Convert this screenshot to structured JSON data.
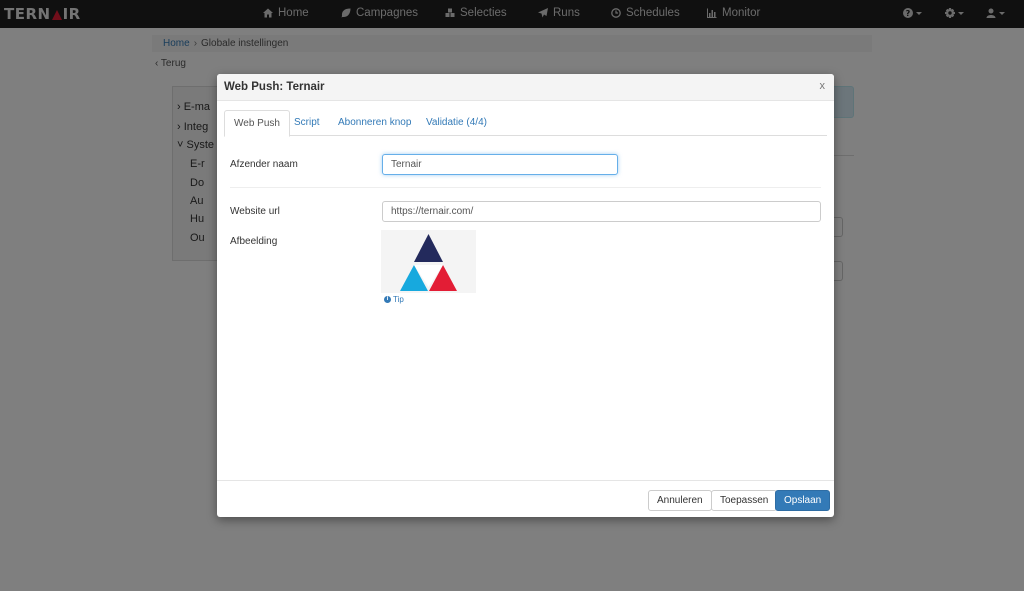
{
  "app": {
    "logo_text_left": "TERN",
    "logo_text_right": "IR"
  },
  "nav": {
    "items": [
      {
        "label": "Home",
        "icon": "home-icon"
      },
      {
        "label": "Campagnes",
        "icon": "leaf-icon"
      },
      {
        "label": "Selecties",
        "icon": "cubes-icon"
      },
      {
        "label": "Runs",
        "icon": "paper-plane-icon"
      },
      {
        "label": "Schedules",
        "icon": "clock-icon"
      },
      {
        "label": "Monitor",
        "icon": "bar-chart-icon"
      }
    ],
    "right_icons": [
      "help-icon",
      "gear-icon",
      "user-icon"
    ]
  },
  "breadcrumb": {
    "home": "Home",
    "separator": "›",
    "current": "Globale instellingen"
  },
  "back_link": "‹ Terug",
  "background_tree": {
    "items": [
      {
        "label": "›  E-ma"
      },
      {
        "label": "›  Integ"
      },
      {
        "label": "˅  Syste"
      },
      {
        "label": "E-r"
      },
      {
        "label": "Do"
      },
      {
        "label": "Au"
      },
      {
        "label": "Hu"
      },
      {
        "label": "Ou"
      }
    ]
  },
  "modal": {
    "title": "Web Push: Ternair",
    "close": "x",
    "tabs": [
      {
        "label": "Web Push",
        "active": true
      },
      {
        "label": "Script",
        "active": false
      },
      {
        "label": "Abonneren knop",
        "active": false
      },
      {
        "label": "Validatie (4/4)",
        "active": false
      }
    ],
    "fields": {
      "sender_label": "Afzender naam",
      "sender_value": "Ternair",
      "url_label": "Website url",
      "url_value": "https://ternair.com/",
      "image_label": "Afbeelding",
      "tip": "Tip"
    },
    "buttons": {
      "cancel": "Annuleren",
      "apply": "Toepassen",
      "save": "Opslaan"
    }
  },
  "colors": {
    "navbar": "#212121",
    "primary": "#337ab7",
    "logo_navy": "#232a5c",
    "logo_cyan": "#17a9de",
    "logo_red": "#e31d35"
  }
}
